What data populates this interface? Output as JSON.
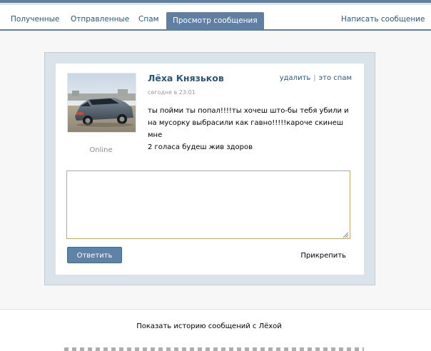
{
  "tabs": {
    "received": "Полученные",
    "sent": "Отправленные",
    "spam": "Спам",
    "view_message": "Просмотр сообщения",
    "write_message": "Написать сообщение"
  },
  "message": {
    "sender_name": "Лёха Князьков",
    "timestamp": "сегодня в 23:01",
    "delete_label": "удалить",
    "spam_label": "это спам",
    "status": "Online",
    "text_line1": "ты пойми ты попал!!!!ты хочеш што-бы тебя убили и",
    "text_line2": "на мусорку выбрасили как гавно!!!!!кароче скинеш мне",
    "text_line3": "2 голаса будеш жив здоров"
  },
  "reply": {
    "input_value": "",
    "send_button": "Ответить",
    "attach_label": "Прикрепить"
  },
  "history_link": "Показать историю сообщений с Лёхой",
  "colors": {
    "accent": "#5f7fa3",
    "link": "#2b587a",
    "button": "#5e82a8",
    "textarea_border": "#c6a86a",
    "frame": "#dae2ea"
  },
  "icons": {
    "avatar": "car-photo",
    "resize": "resize-grip-icon"
  }
}
